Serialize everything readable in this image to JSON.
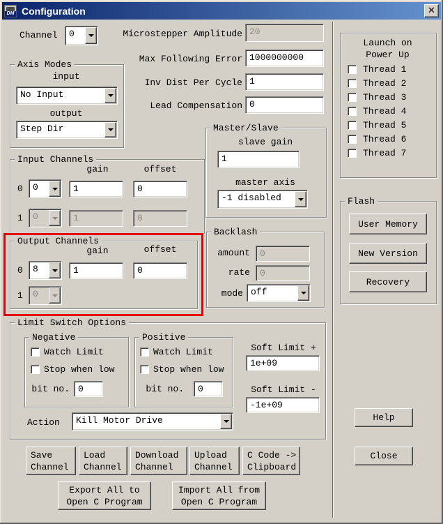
{
  "colors": {
    "highlight": "#e60000",
    "titlebar_start": "#0a246a",
    "titlebar_end": "#6593cf"
  },
  "window": {
    "title": "Configuration",
    "close_label": "✕",
    "icon_text": "DM"
  },
  "channel": {
    "label": "Channel",
    "value": "0"
  },
  "params": {
    "microstepper_label": "Microstepper Amplitude",
    "microstepper_value": "20",
    "max_follow_label": "Max Following Error",
    "max_follow_value": "1000000000",
    "inv_dist_label": "Inv Dist Per Cycle",
    "inv_dist_value": "1",
    "lead_comp_label": "Lead Compensation",
    "lead_comp_value": "0"
  },
  "axis_modes": {
    "legend": "Axis Modes",
    "input_label": "input",
    "input_value": "No Input",
    "output_label": "output",
    "output_value": "Step Dir"
  },
  "input_channels": {
    "legend": "Input Channels",
    "gain_header": "gain",
    "offset_header": "offset",
    "rows": [
      {
        "index": "0",
        "channel": "0",
        "gain": "1",
        "offset": "0"
      },
      {
        "index": "1",
        "channel": "0",
        "gain": "1",
        "offset": "0"
      }
    ]
  },
  "master_slave": {
    "legend": "Master/Slave",
    "slave_gain_label": "slave gain",
    "slave_gain_value": "1",
    "master_axis_label": "master axis",
    "master_axis_value": "-1 disabled"
  },
  "output_channels": {
    "legend": "Output Channels",
    "gain_header": "gain",
    "offset_header": "offset",
    "rows": [
      {
        "index": "0",
        "channel": "8",
        "gain": "1",
        "offset": "0"
      },
      {
        "index": "1",
        "channel": "0"
      }
    ]
  },
  "backlash": {
    "legend": "Backlash",
    "amount_label": "amount",
    "amount_value": "0",
    "rate_label": "rate",
    "rate_value": "0",
    "mode_label": "mode",
    "mode_value": "off"
  },
  "limit_switch": {
    "legend": "Limit Switch Options",
    "negative": {
      "legend": "Negative",
      "watch_label": "Watch Limit",
      "stop_label": "Stop when low",
      "bit_label": "bit no.",
      "bit_value": "0"
    },
    "positive": {
      "legend": "Positive",
      "watch_label": "Watch Limit",
      "stop_label": "Stop when low",
      "bit_label": "bit no.",
      "bit_value": "0"
    },
    "soft_plus_label": "Soft Limit +",
    "soft_plus_value": "1e+09",
    "soft_minus_label": "Soft Limit -",
    "soft_minus_value": "-1e+09",
    "action_label": "Action",
    "action_value": "Kill Motor Drive"
  },
  "channel_buttons": {
    "save": "Save Channel",
    "load": "Load Channel",
    "download": "Download Channel",
    "upload": "Upload Channel",
    "c_code": "C Code -> Clipboard",
    "export_all": "Export All to Open C Program",
    "import_all": "Import All from Open C Program"
  },
  "launch": {
    "title_line1": "Launch on",
    "title_line2": "Power Up",
    "threads": [
      "Thread 1",
      "Thread 2",
      "Thread 3",
      "Thread 4",
      "Thread 5",
      "Thread 6",
      "Thread 7"
    ]
  },
  "flash": {
    "legend": "Flash",
    "user_memory": "User Memory",
    "new_version": "New Version",
    "recovery": "Recovery"
  },
  "side_buttons": {
    "help": "Help",
    "close": "Close"
  }
}
